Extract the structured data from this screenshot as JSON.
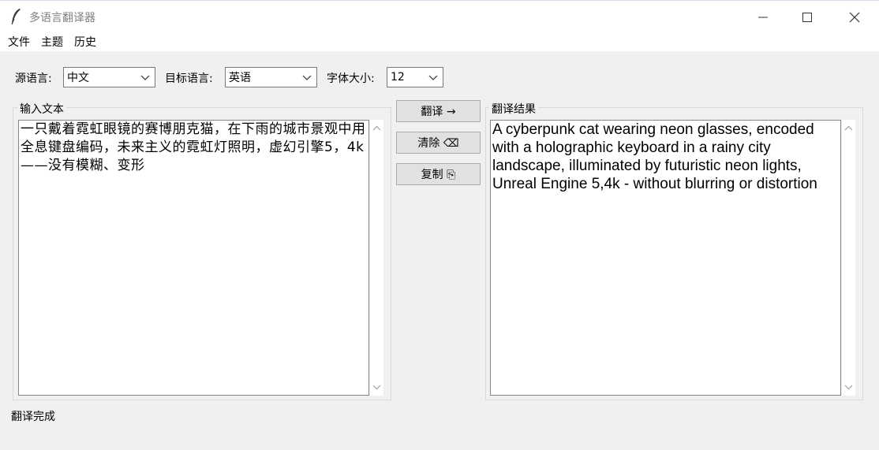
{
  "window": {
    "title": "多语言翻译器"
  },
  "menu": {
    "items": [
      "文件",
      "主题",
      "历史"
    ]
  },
  "controls": {
    "source_label": "源语言:",
    "source_value": "中文",
    "target_label": "目标语言:",
    "target_value": "英语",
    "font_label": "字体大小:",
    "font_value": "12"
  },
  "input": {
    "group_label": "输入文本",
    "text": "一只戴着霓虹眼镜的赛博朋克猫，在下雨的城市景观中用全息键盘编码，未来主义的霓虹灯照明，虚幻引擎5，4k——没有模糊、变形"
  },
  "buttons": {
    "translate": "翻译 →",
    "clear": "清除 ⌫",
    "copy": "复制 ⎘"
  },
  "output": {
    "group_label": "翻译结果",
    "text": "A cyberpunk cat wearing neon glasses, encoded with a holographic keyboard in a rainy city landscape, illuminated by futuristic neon lights, Unreal Engine 5,4k - without blurring or distortion"
  },
  "status": {
    "text": "翻译完成"
  },
  "icons": {
    "app": "feather-icon",
    "minimize": "minimize-icon",
    "maximize": "maximize-icon",
    "close": "close-icon"
  }
}
